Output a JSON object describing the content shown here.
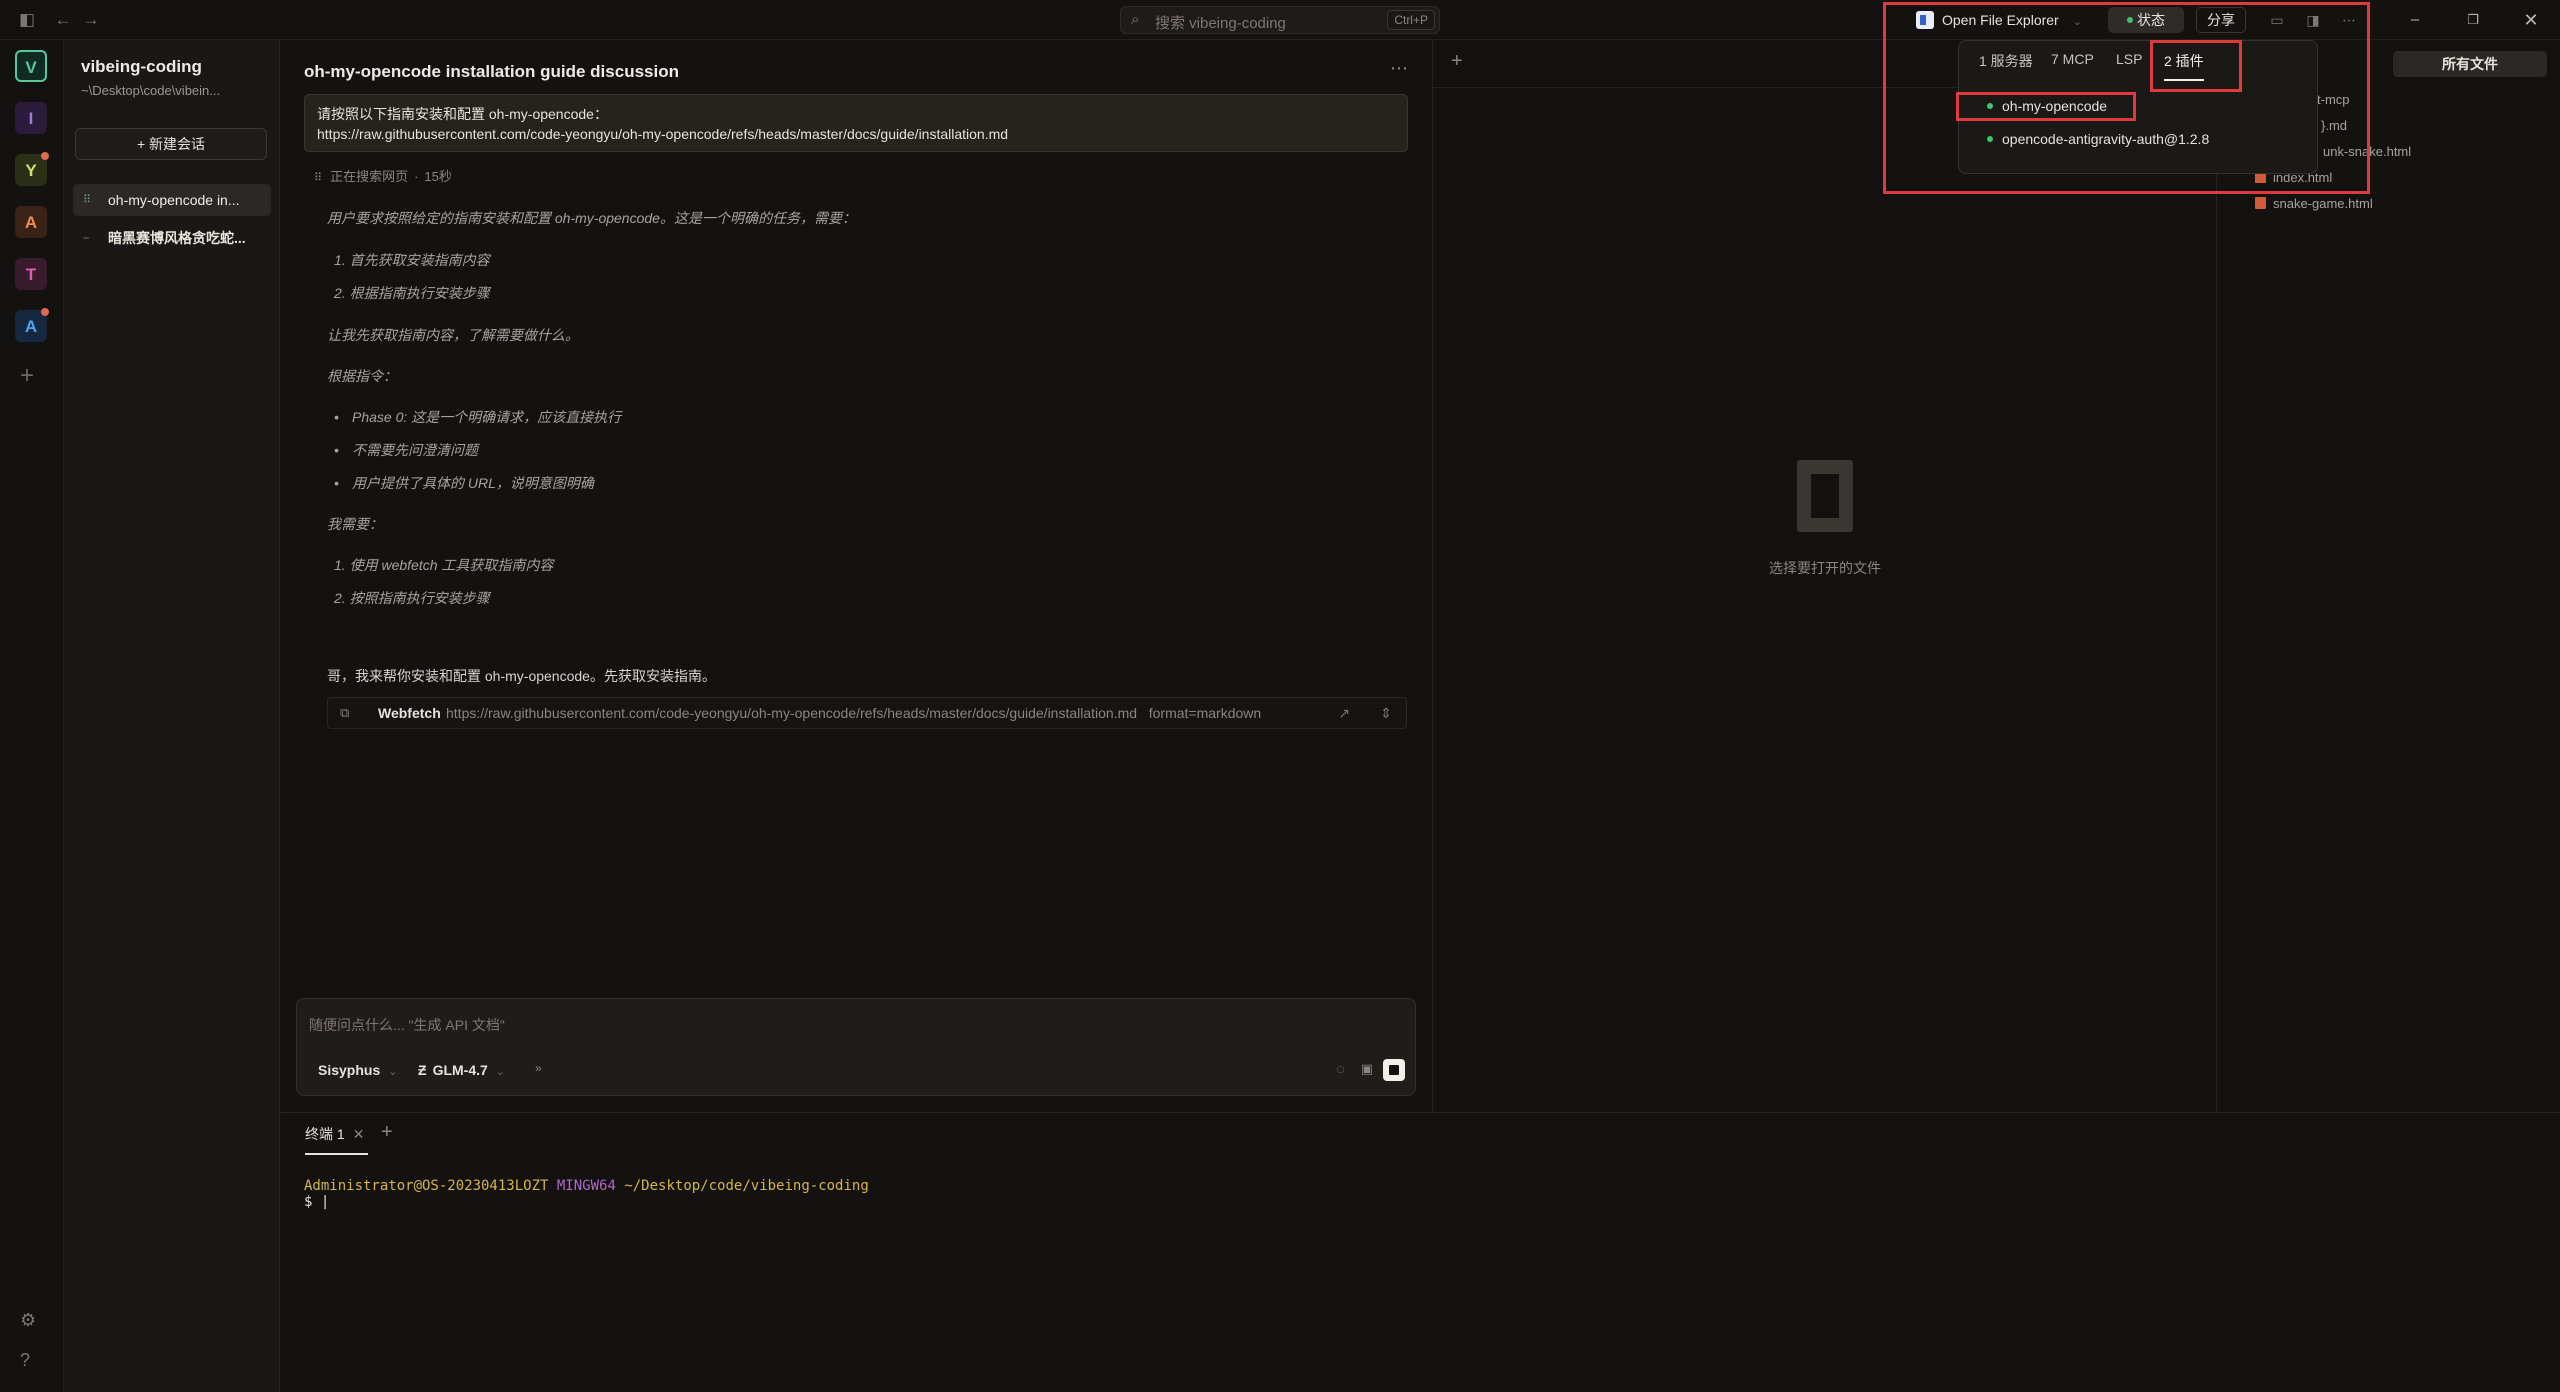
{
  "topbar": {
    "search_placeholder": "搜索 vibeing-coding",
    "search_shortcut": "Ctrl+P"
  },
  "toolbar": {
    "open_file_explorer": "Open File Explorer",
    "status": "状态",
    "share": "分享"
  },
  "rail": {
    "projects": [
      {
        "letter": "V",
        "color": "#58c79a",
        "bg": "#0f2a22",
        "active": true,
        "badge": false
      },
      {
        "letter": "I",
        "color": "#a775e0",
        "bg": "#2a1c3a",
        "active": false,
        "badge": false
      },
      {
        "letter": "Y",
        "color": "#d2e36a",
        "bg": "#2a2f16",
        "active": false,
        "badge": true
      },
      {
        "letter": "A",
        "color": "#f08a4f",
        "bg": "#3a2216",
        "active": false,
        "badge": false
      },
      {
        "letter": "T",
        "color": "#e25ca8",
        "bg": "#3a1a2d",
        "active": false,
        "badge": false
      },
      {
        "letter": "A",
        "color": "#4fa3f0",
        "bg": "#15283f",
        "active": false,
        "badge": true
      }
    ]
  },
  "sidebar": {
    "workspace_title": "vibeing-coding",
    "workspace_path": "~\\Desktop\\code\\vibein...",
    "new_session_label": "+ 新建会话",
    "sessions": [
      {
        "label": "oh-my-opencode in...",
        "active": true
      },
      {
        "label": "暗黑赛博风格贪吃蛇...",
        "active": false
      }
    ]
  },
  "chat": {
    "title": "oh-my-opencode installation guide discussion",
    "user_message_line1": "请按照以下指南安装和配置 oh-my-opencode：",
    "user_message_line2": "https://raw.githubusercontent.com/code-yeongyu/oh-my-opencode/refs/heads/master/docs/guide/installation.md",
    "searching_label": "正在搜索网页",
    "searching_time": "15秒",
    "thinking": {
      "intro": "用户要求按照给定的指南安装和配置 oh-my-opencode。这是一个明确的任务，需要：",
      "steps_a": [
        "1. 首先获取安装指南内容",
        "2. 根据指南执行安装步骤"
      ],
      "para2": "让我先获取指南内容，了解需要做什么。",
      "para3": "根据指令：",
      "bullets": [
        "Phase 0: 这是一个明确请求，应该直接执行",
        "不需要先问澄清问题",
        "用户提供了具体的 URL，说明意图明确"
      ],
      "para4": "我需要：",
      "steps_b": [
        "1. 使用 webfetch 工具获取指南内容",
        "2. 按照指南执行安装步骤"
      ]
    },
    "reply": "哥，我来帮你安装和配置 oh-my-opencode。先获取安装指南。",
    "webfetch": {
      "label": "Webfetch",
      "url": "https://raw.githubusercontent.com/code-yeongyu/oh-my-opencode/refs/heads/master/docs/guide/installation.md",
      "args": "format=markdown"
    },
    "composer": {
      "placeholder": "随便问点什么... \"生成 API 文档\"",
      "agent": "Sisyphus",
      "model": "GLM-4.7"
    }
  },
  "terminal": {
    "tab_label": "终端 1",
    "user_host": "Administrator@OS-20230413LOZT",
    "shell": "MINGW64",
    "cwd": "~/Desktop/code/vibeing-coding",
    "prompt": "$ |"
  },
  "viewer": {
    "empty_label": "选择要打开的文件"
  },
  "files": {
    "all_files_label": "所有文件",
    "partial_items": [
      "t-mcp",
      "}.md",
      "unk-snake.html"
    ],
    "items": [
      "index.html",
      "snake-game.html"
    ]
  },
  "popup": {
    "tabs": [
      "1 服务器",
      "7 MCP",
      "LSP",
      "2 插件"
    ],
    "active_tab": 3,
    "plugins": [
      "oh-my-opencode",
      "opencode-antigravity-auth@1.2.8"
    ]
  }
}
